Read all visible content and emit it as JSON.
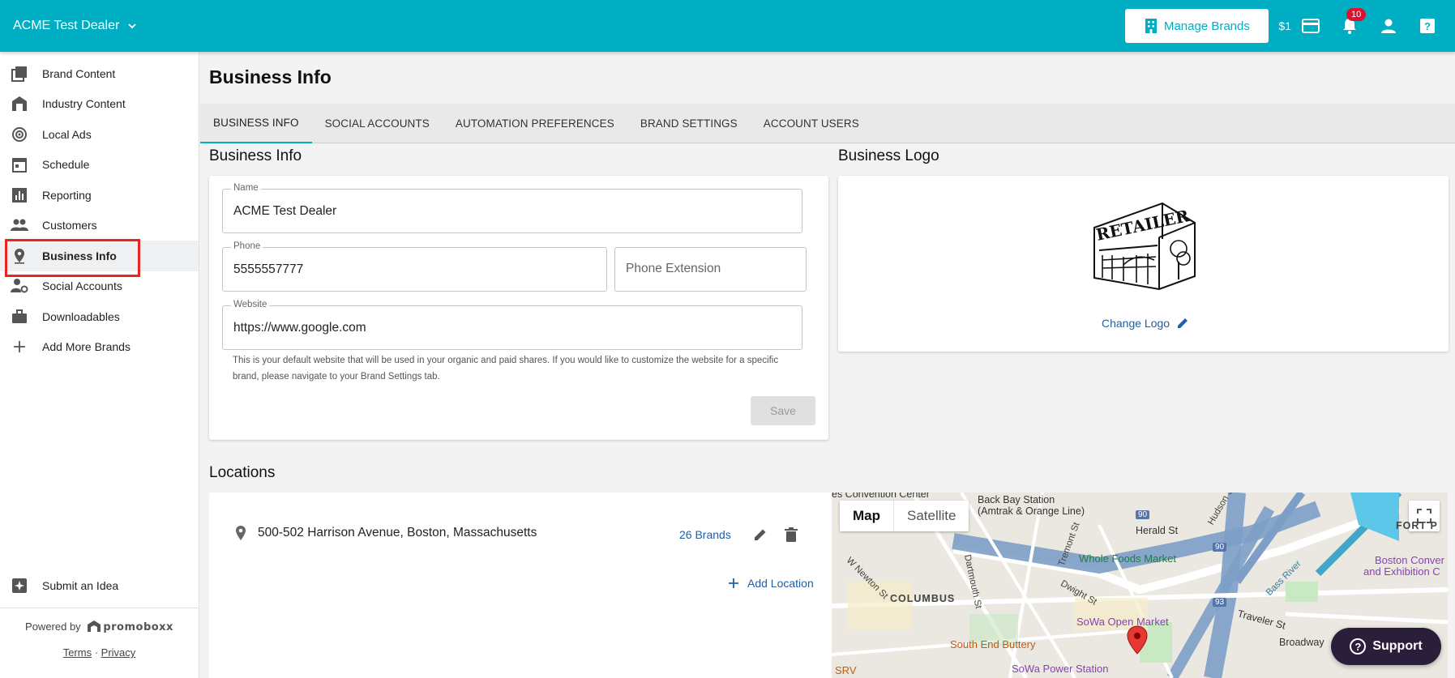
{
  "topbar": {
    "dealer_name": "ACME Test Dealer",
    "manage_brands_label": "Manage Brands",
    "credit": "$1",
    "notification_count": "10",
    "accent_color": "#00aec3"
  },
  "sidebar": {
    "items": [
      {
        "label": "Brand Content",
        "icon": "brand-content-icon"
      },
      {
        "label": "Industry Content",
        "icon": "industry-content-icon"
      },
      {
        "label": "Local Ads",
        "icon": "local-ads-icon"
      },
      {
        "label": "Schedule",
        "icon": "calendar-icon"
      },
      {
        "label": "Reporting",
        "icon": "bar-chart-icon"
      },
      {
        "label": "Customers",
        "icon": "people-icon"
      },
      {
        "label": "Business Info",
        "icon": "map-pin-icon"
      },
      {
        "label": "Social Accounts",
        "icon": "person-gear-icon"
      },
      {
        "label": "Downloadables",
        "icon": "briefcase-icon"
      },
      {
        "label": "Add More Brands",
        "icon": "plus-icon"
      }
    ],
    "submit_idea": "Submit an Idea",
    "powered_by": "Powered by",
    "brand": "promoboxx",
    "terms": "Terms",
    "separator": "·",
    "privacy": "Privacy"
  },
  "page": {
    "title": "Business Info",
    "tabs": [
      "BUSINESS INFO",
      "SOCIAL ACCOUNTS",
      "AUTOMATION PREFERENCES",
      "BRAND SETTINGS",
      "ACCOUNT USERS"
    ]
  },
  "business_info": {
    "section_title": "Business Info",
    "name_label": "Name",
    "name_value": "ACME Test Dealer",
    "phone_label": "Phone",
    "phone_value": "5555557777",
    "phone_ext_placeholder": "Phone Extension",
    "website_label": "Website",
    "website_value": "https://www.google.com",
    "helper_text": "This is your default website that will be used in your organic and paid shares. If you would like to customize the website for a specific brand, please navigate to your Brand Settings tab.",
    "save_label": "Save"
  },
  "business_logo": {
    "section_title": "Business Logo",
    "logo_text": "RETAILER",
    "change_logo_label": "Change Logo"
  },
  "locations": {
    "section_title": "Locations",
    "address": "500-502 Harrison Avenue, Boston, Massachusetts",
    "brands_count": "26 Brands",
    "add_location_label": "Add Location"
  },
  "map": {
    "map_label": "Map",
    "satellite_label": "Satellite",
    "labels": {
      "back_bay": "Back Bay Station",
      "amtrak": "(Amtrak & Orange Line)",
      "herald": "Herald St",
      "hudson": "Hudson St",
      "fort": "FORT P",
      "whole_foods": "Whole Foods Market",
      "columbus": "COLUMBUS",
      "tremont": "Tremont St",
      "dartmouth": "Dartmouth St",
      "w_newton": "W Newton St",
      "dwight": "Dwight St",
      "sowa_open": "SoWa Open Market",
      "south_end": "South End Buttery",
      "sowa_power": "SoWa Power Station",
      "traveler": "Traveler St",
      "broadway": "Broadway",
      "boston_conv": "Boston Conver",
      "exhibition": "and Exhibition C",
      "convention": "es Convention Center",
      "bass_river": "Bass River",
      "srv": "SRV",
      "i90": "90",
      "i93": "93"
    }
  },
  "support_label": "Support"
}
